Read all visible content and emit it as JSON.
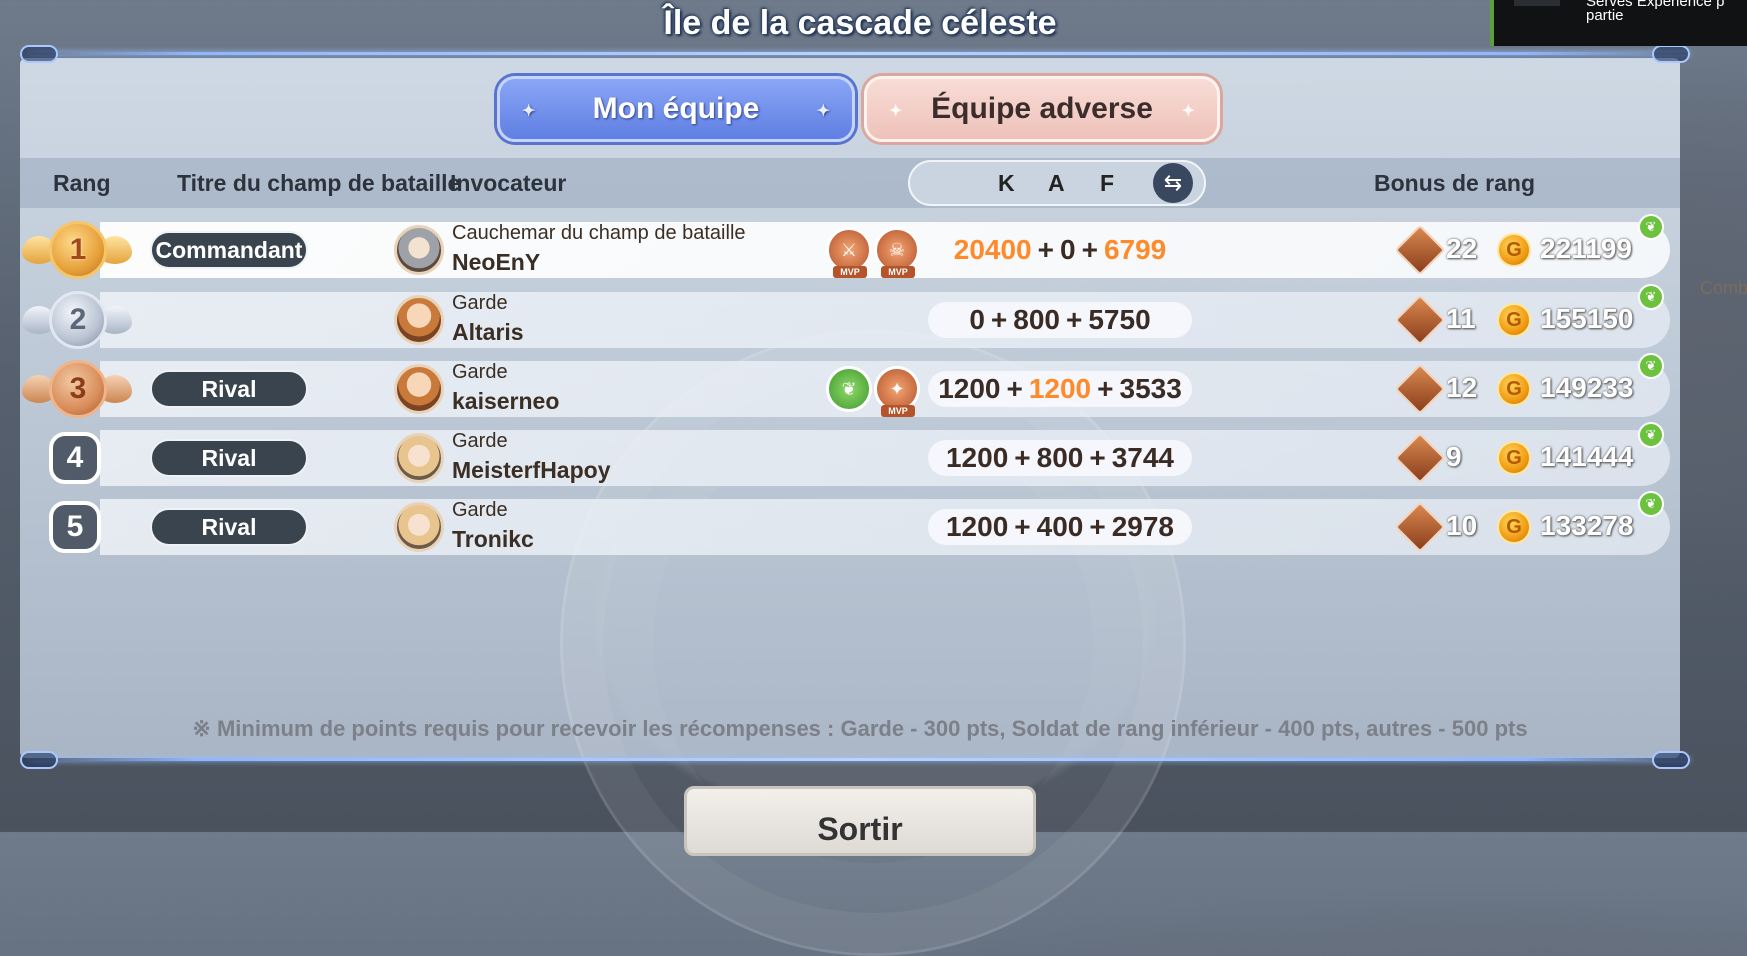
{
  "title": "Île de la cascade céleste",
  "notification": {
    "line1": "Serves Experience p",
    "line2": "partie"
  },
  "tabs": [
    {
      "label": "Mon équipe",
      "active": true
    },
    {
      "label": "Équipe adverse",
      "active": false
    }
  ],
  "headers": {
    "rank": "Rang",
    "battle_title": "Titre du champ de bataille",
    "summoner": "Invocateur",
    "k": "K",
    "a": "A",
    "f": "F",
    "rank_bonus": "Bonus de rang"
  },
  "rows": [
    {
      "rank": "1",
      "title": "Commandant",
      "role": "Cauchemar du champ de bataille",
      "name": "NeoEnY",
      "k": "20400",
      "a": "0",
      "f": "6799",
      "crystals": "22",
      "coins": "221199"
    },
    {
      "rank": "2",
      "title": "",
      "role": "Garde",
      "name": "Altaris",
      "k": "0",
      "a": "800",
      "f": "5750",
      "crystals": "11",
      "coins": "155150"
    },
    {
      "rank": "3",
      "title": "Rival",
      "role": "Garde",
      "name": "kaiserneo",
      "k": "1200",
      "a": "1200",
      "f": "3533",
      "crystals": "12",
      "coins": "149233"
    },
    {
      "rank": "4",
      "title": "Rival",
      "role": "Garde",
      "name": "MeisterfHapoy",
      "k": "1200",
      "a": "800",
      "f": "3744",
      "crystals": "9",
      "coins": "141444"
    },
    {
      "rank": "5",
      "title": "Rival",
      "role": "Garde",
      "name": "Tronikc",
      "k": "1200",
      "a": "400",
      "f": "2978",
      "crystals": "10",
      "coins": "133278"
    }
  ],
  "mvp_label": "MVP",
  "plus": "+",
  "footnote": "※ Minimum de points requis pour recevoir les récompenses : Garde - 300 pts, Soldat de rang inférieur - 400 pts, autres - 500 pts",
  "exit_label": "Sortir",
  "side_text": "Comb",
  "colors": {
    "accent_orange": "#ff8a2a",
    "tab_blue": "#6f8ee8",
    "tab_pink": "#f0c8c0",
    "pill_dark": "#3a444e"
  },
  "icons": [
    "swap-icon",
    "crystal-icon",
    "gold-coin-icon",
    "leaf-icon",
    "mvp-medal-icon",
    "rank-badge-icon"
  ]
}
